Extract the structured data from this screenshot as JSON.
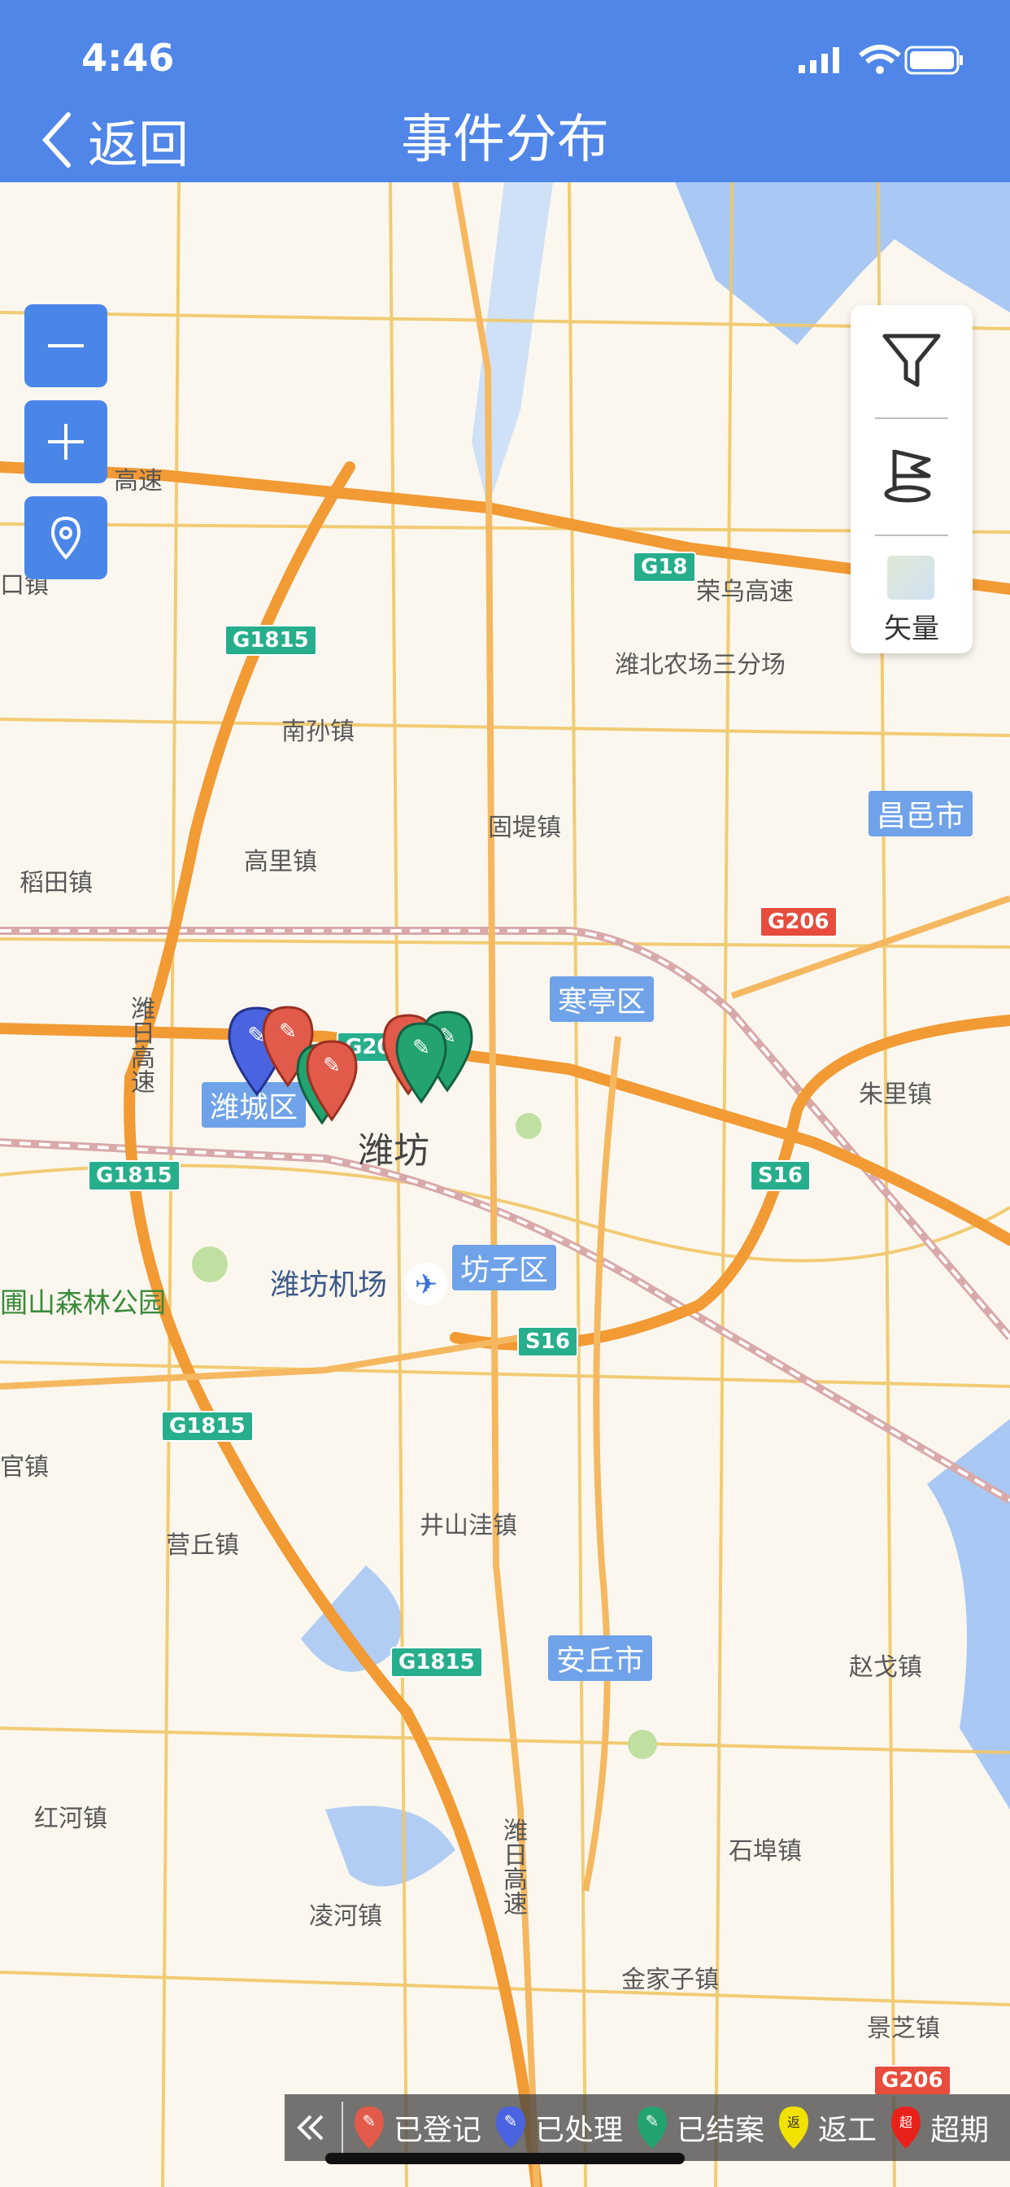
{
  "status_bar": {
    "time": "4:46"
  },
  "nav": {
    "back_label": "返回",
    "title": "事件分布"
  },
  "map_controls": {
    "zoom_out": "zoom-out",
    "zoom_in": "zoom-in",
    "locate": "location-pin"
  },
  "right_panel": {
    "layer_label": "矢量"
  },
  "map_labels": {
    "places": [
      "南孙镇",
      "高里镇",
      "固堤镇",
      "潍北农场三分场",
      "稻田镇",
      "朱里镇",
      "潍坊机场",
      "井山洼镇",
      "营丘镇",
      "赵戈镇",
      "红河镇",
      "凌河镇",
      "石埠镇",
      "金家子镇",
      "景芝镇",
      "官镇",
      "潍坊",
      "口镇",
      "圃山森林公园"
    ],
    "cities": [
      "昌邑市",
      "寒亭区",
      "潍城区",
      "坊子区",
      "安丘市"
    ],
    "roads": [
      "G1815",
      "G1815",
      "G1815",
      "G1815",
      "G18",
      "G206",
      "G206",
      "S16",
      "S16",
      "G20"
    ],
    "road_names": [
      "荣乌高速",
      "潍日高速",
      "潍日高速",
      "高速"
    ]
  },
  "legend": {
    "items": [
      {
        "label": "已登记",
        "color": "#e25b4a",
        "glyph": "✎"
      },
      {
        "label": "已处理",
        "color": "#4a63e0",
        "glyph": "✎"
      },
      {
        "label": "已结案",
        "color": "#23a36f",
        "glyph": "✎"
      },
      {
        "label": "返工",
        "color": "#f2e200",
        "glyph": "返"
      },
      {
        "label": "超期",
        "color": "#e8221b",
        "glyph": "超"
      }
    ]
  }
}
